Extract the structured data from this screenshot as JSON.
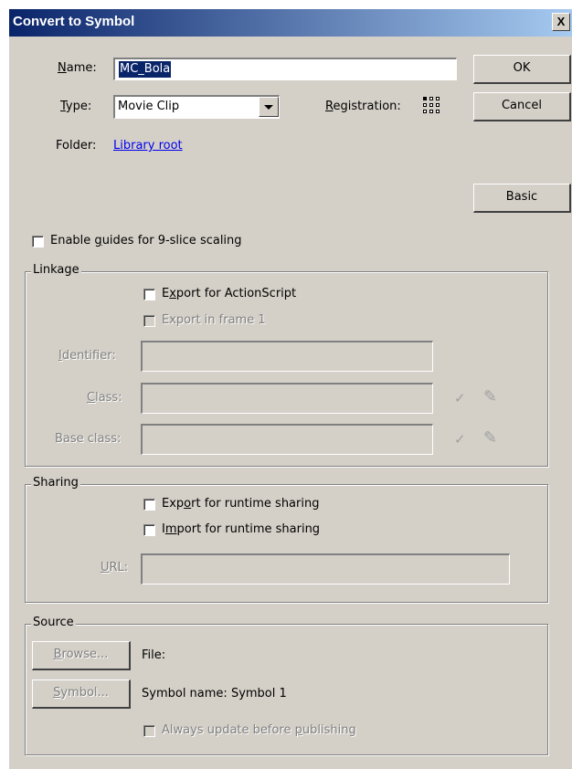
{
  "window": {
    "title": "Convert to Symbol",
    "close_glyph": "X"
  },
  "name": {
    "label_u": "N",
    "label_rest": "ame:",
    "value": "MC_Bola"
  },
  "type": {
    "label_u": "T",
    "label_rest": "ype:",
    "value": "Movie Clip"
  },
  "registration": {
    "label_u": "R",
    "label_rest": "egistration:",
    "icon": "registration-grid-icon"
  },
  "folder": {
    "label": "Folder:",
    "link": "Library root"
  },
  "buttons": {
    "ok": "OK",
    "cancel": "Cancel",
    "basic": "Basic"
  },
  "nine_slice": {
    "pre": "Enable ",
    "u": "g",
    "post": "uides for 9-slice scaling"
  },
  "linkage": {
    "legend": "Linkage",
    "export_as": {
      "pre": "E",
      "u": "x",
      "post": "port for ActionScript"
    },
    "export_frame1": "Export in frame 1",
    "identifier": {
      "u": "I",
      "rest": "dentifier:"
    },
    "class": {
      "u": "C",
      "rest": "lass:"
    },
    "base_class": "Base class:",
    "check_glyph": "✓",
    "pencil_glyph": "✎"
  },
  "sharing": {
    "legend": "Sharing",
    "export_runtime": {
      "pre": "Exp",
      "u": "o",
      "post": "rt for runtime sharing"
    },
    "import_runtime": {
      "pre": "I",
      "u": "m",
      "post": "port for runtime sharing"
    },
    "url": {
      "u": "U",
      "rest": "RL:"
    }
  },
  "source": {
    "legend": "Source",
    "browse": {
      "u": "B",
      "rest": "rowse..."
    },
    "symbol": {
      "u": "S",
      "rest": "ymbol..."
    },
    "file_label": "File:",
    "symbol_name": "Symbol name: Symbol 1",
    "always_update": {
      "pre": "Always update before ",
      "u": "p",
      "post": "ublishing"
    }
  },
  "colors": {
    "face": "#d4d0c8",
    "title_start": "#0a246a",
    "title_end": "#a6caf0",
    "link": "#0000ee"
  }
}
